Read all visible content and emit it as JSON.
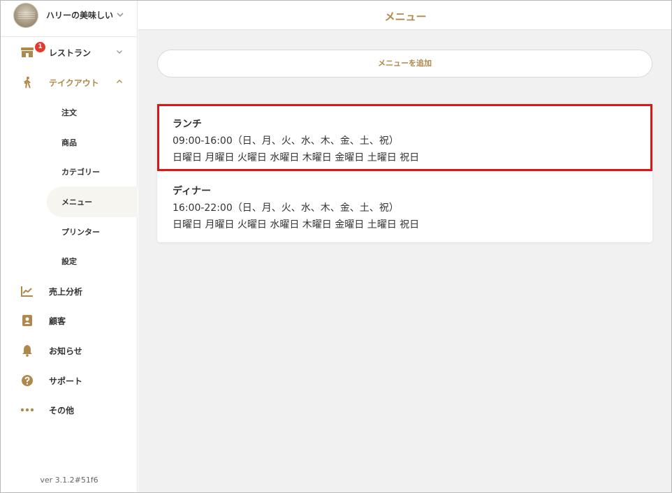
{
  "app": {
    "account_name": "ハリーの美味しい…",
    "version": "ver 3.1.2#51f6"
  },
  "colors": {
    "accent": "#b0884b",
    "badge": "#e23b2e",
    "highlight_border": "#e01414",
    "main_background": "#f1f1f1"
  },
  "sidebar": {
    "restaurant": {
      "label": "レストラン",
      "badge": "1",
      "icon": "store-icon"
    },
    "takeout": {
      "label": "テイクアウト",
      "icon": "walking-person-icon",
      "expanded": true
    },
    "takeout_items": [
      {
        "label": "注文"
      },
      {
        "label": "商品"
      },
      {
        "label": "カテゴリー"
      },
      {
        "label": "メニュー",
        "active": true
      },
      {
        "label": "プリンター"
      },
      {
        "label": "設定"
      }
    ],
    "items": [
      {
        "label": "売上分析",
        "icon": "chart-icon"
      },
      {
        "label": "顧客",
        "icon": "address-book-icon"
      },
      {
        "label": "お知らせ",
        "icon": "bell-icon"
      },
      {
        "label": "サポート",
        "icon": "help-icon"
      },
      {
        "label": "その他",
        "icon": "more-icon"
      }
    ]
  },
  "main": {
    "title": "メニュー",
    "add_button": "メニューを追加",
    "menus": [
      {
        "name": "ランチ",
        "hours": "09:00-16:00（日、月、火、水、木、金、土、祝）",
        "days": "日曜日 月曜日 火曜日 水曜日 木曜日 金曜日 土曜日 祝日",
        "highlighted": true
      },
      {
        "name": "ディナー",
        "hours": "16:00-22:00（日、月、火、水、木、金、土、祝）",
        "days": "日曜日 月曜日 火曜日 水曜日 木曜日 金曜日 土曜日 祝日",
        "highlighted": false
      }
    ]
  }
}
